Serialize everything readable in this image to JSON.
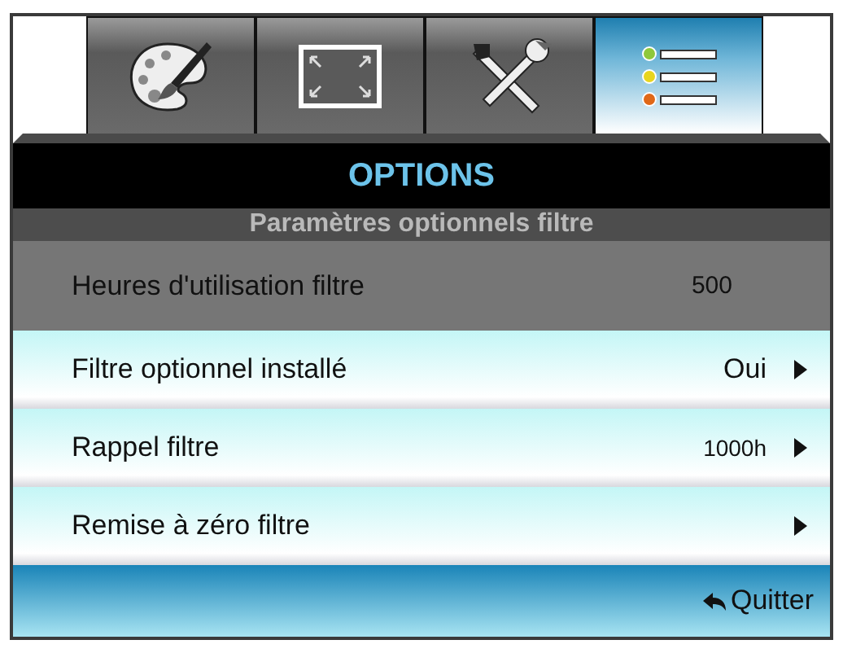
{
  "tabs": [
    {
      "kind": "palette",
      "selected": false
    },
    {
      "kind": "screen",
      "selected": false
    },
    {
      "kind": "tools",
      "selected": false
    },
    {
      "kind": "options",
      "selected": true
    }
  ],
  "title": "OPTIONS",
  "subtitle": "Paramètres optionnels filtre",
  "rows": [
    {
      "kind": "readonly",
      "label": "Heures d'utilisation filtre",
      "value": "500"
    },
    {
      "kind": "submenu",
      "label": "Filtre optionnel installé",
      "value": "Oui"
    },
    {
      "kind": "submenu",
      "label": "Rappel filtre",
      "value": "1000h"
    },
    {
      "kind": "submenu",
      "label": "Remise à zéro filtre"
    }
  ],
  "footer": {
    "exit": "Quitter"
  }
}
